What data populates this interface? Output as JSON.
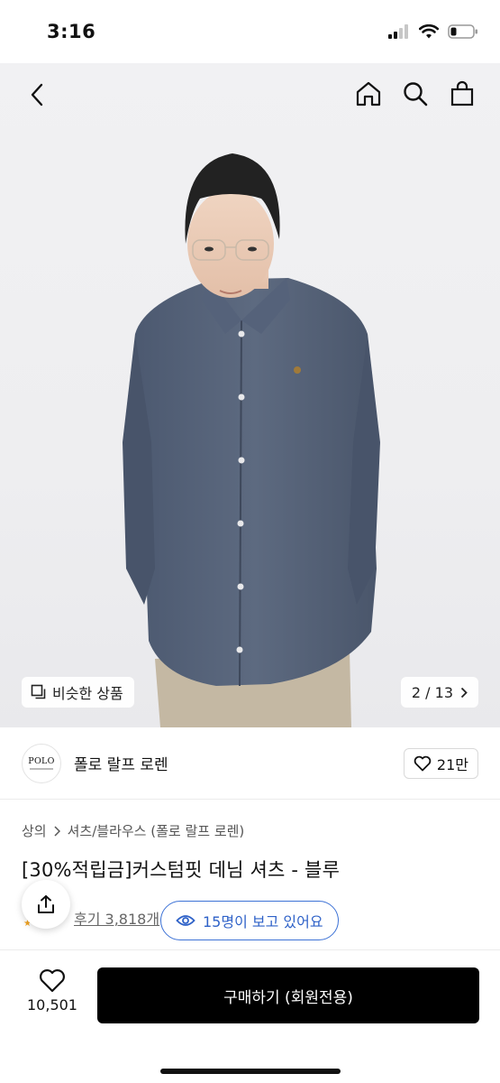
{
  "status": {
    "time": "3:16"
  },
  "nav": {
    "back_icon": "chevron-left-icon",
    "icons": [
      "home-icon",
      "search-icon",
      "shopping-bag-icon"
    ]
  },
  "gallery": {
    "similar_label": "비슷한 상품",
    "counter": "2 / 13"
  },
  "brand": {
    "logo_text": "POLO",
    "name": "폴로 랄프 로렌",
    "likes": "21만"
  },
  "breadcrumb": {
    "root": "상의",
    "category": "셔츠/블라우스 (폴로 랄프 로렌)"
  },
  "product": {
    "title": "[30%적립금]커스텀핏 데님 셔츠 - 블루",
    "reviews": "후기 3,818개",
    "viewers": "15명이 보고 있어요"
  },
  "bottom": {
    "wish_count": "10,501",
    "buy_label": "구매하기 (회원전용)"
  },
  "colors": {
    "accent_blue": "#2f62c8",
    "buy_button": "#000000",
    "rating_star": "#f5a623"
  }
}
